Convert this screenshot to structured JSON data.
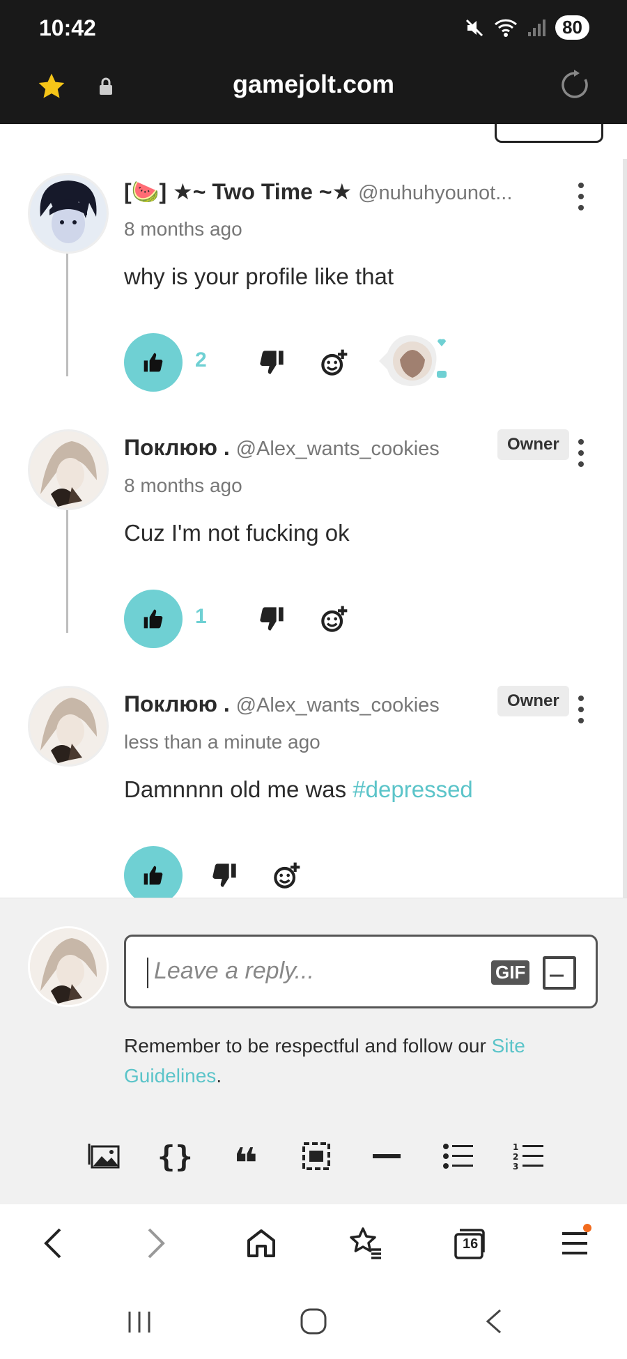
{
  "status_bar": {
    "time": "10:42",
    "battery": "80"
  },
  "url_bar": {
    "domain": "gamejolt.com"
  },
  "comments": [
    {
      "display_name": "[🍉] ★~ Two Time ~★",
      "username": "@nuhuhyounot...",
      "time_ago": "8 months ago",
      "text": "why is your profile like that",
      "like_count": "2",
      "owner_badge": ""
    },
    {
      "display_name": "Поклюю .",
      "username": "@Alex_wants_cookies",
      "time_ago": "8 months ago",
      "text": "Cuz I'm not fucking ok",
      "like_count": "1",
      "owner_badge": "Owner"
    },
    {
      "display_name": "Поклюю .",
      "username": "@Alex_wants_cookies",
      "time_ago": "less than a minute ago",
      "text_before": "Damnnnn old me was ",
      "hashtag": "#depressed",
      "like_count": "",
      "owner_badge": "Owner"
    }
  ],
  "reply": {
    "placeholder": "Leave a reply...",
    "gif_label": "GIF",
    "guideline_text": "Remember to be respectful and follow our ",
    "guideline_link": "Site Guidelines",
    "guideline_end": "."
  },
  "toolbar": {
    "items": [
      "image-icon",
      "code-block-icon",
      "quote-icon",
      "embed-icon",
      "divider-icon",
      "bullet-list-icon",
      "numbered-list-icon"
    ]
  },
  "browser_nav": {
    "tab_count": "16"
  },
  "colors": {
    "accent": "#6fd0d3",
    "link": "#5bc4c9",
    "topbar": "#191919",
    "notification": "#f26b1d"
  }
}
